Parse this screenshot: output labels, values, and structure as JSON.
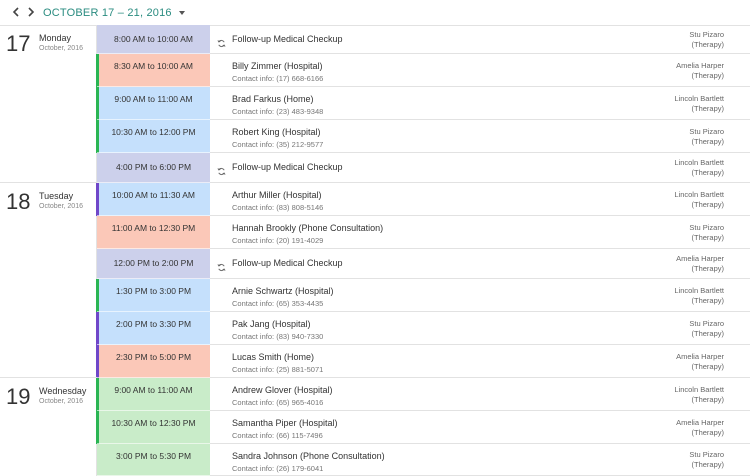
{
  "toolbar": {
    "range_label": "OCTOBER 17 – 21, 2016",
    "prev_icon": "chevron-left-icon",
    "next_icon": "chevron-right-icon"
  },
  "colors": {
    "accent": "#2a8c80",
    "purple_slot": "#ccd0eb",
    "salmon_slot": "#fbc8b8",
    "blue_slot": "#c5e0fc",
    "green_slot": "#c9ecc9",
    "green_marker": "#2ab553",
    "violet_marker": "#6f47c9"
  },
  "days": [
    {
      "num": "17",
      "name": "Monday",
      "month": "October, 2016"
    },
    {
      "num": "18",
      "name": "Tuesday",
      "month": "October, 2016"
    },
    {
      "num": "19",
      "name": "Wednesday",
      "month": "October, 2016"
    }
  ],
  "appointments": [
    {
      "day": 0,
      "time": "8:00 AM to 10:00 AM",
      "subject": "Follow-up Medical Checkup",
      "contact": "",
      "recurring": true,
      "resource": "Stu Pizaro",
      "dept": "(Therapy)",
      "color": "purple",
      "marker": ""
    },
    {
      "day": 0,
      "time": "8:30 AM to 10:00 AM",
      "subject": "Billy Zimmer (Hospital)",
      "contact": "Contact info: (17) 668-6166",
      "recurring": false,
      "resource": "Amelia Harper",
      "dept": "(Therapy)",
      "color": "salmon",
      "marker": "green"
    },
    {
      "day": 0,
      "time": "9:00 AM to 11:00 AM",
      "subject": "Brad Farkus (Home)",
      "contact": "Contact info: (23) 483-9348",
      "recurring": false,
      "resource": "Lincoln Bartlett",
      "dept": "(Therapy)",
      "color": "blue",
      "marker": "green"
    },
    {
      "day": 0,
      "time": "10:30 AM to 12:00 PM",
      "subject": "Robert King (Hospital)",
      "contact": "Contact info: (35) 212-9577",
      "recurring": false,
      "resource": "Stu Pizaro",
      "dept": "(Therapy)",
      "color": "blue",
      "marker": "green"
    },
    {
      "day": 0,
      "time": "4:00 PM to 6:00 PM",
      "subject": "Follow-up Medical Checkup",
      "contact": "",
      "recurring": true,
      "resource": "Lincoln Bartlett",
      "dept": "(Therapy)",
      "color": "purple",
      "marker": ""
    },
    {
      "day": 1,
      "time": "10:00 AM to 11:30 AM",
      "subject": "Arthur Miller (Hospital)",
      "contact": "Contact info: (83) 808-5146",
      "recurring": false,
      "resource": "Lincoln Bartlett",
      "dept": "(Therapy)",
      "color": "blue",
      "marker": "violet"
    },
    {
      "day": 1,
      "time": "11:00 AM to 12:30 PM",
      "subject": "Hannah Brookly (Phone Consultation)",
      "contact": "Contact info: (20) 191-4029",
      "recurring": false,
      "resource": "Stu Pizaro",
      "dept": "(Therapy)",
      "color": "salmon",
      "marker": ""
    },
    {
      "day": 1,
      "time": "12:00 PM to 2:00 PM",
      "subject": "Follow-up Medical Checkup",
      "contact": "",
      "recurring": true,
      "resource": "Amelia Harper",
      "dept": "(Therapy)",
      "color": "purple",
      "marker": ""
    },
    {
      "day": 1,
      "time": "1:30 PM to 3:00 PM",
      "subject": "Arnie Schwartz (Hospital)",
      "contact": "Contact info: (65) 353-4435",
      "recurring": false,
      "resource": "Lincoln Bartlett",
      "dept": "(Therapy)",
      "color": "blue",
      "marker": "green"
    },
    {
      "day": 1,
      "time": "2:00 PM to 3:30 PM",
      "subject": "Pak Jang (Hospital)",
      "contact": "Contact info: (83) 940-7330",
      "recurring": false,
      "resource": "Stu Pizaro",
      "dept": "(Therapy)",
      "color": "blue",
      "marker": "violet"
    },
    {
      "day": 1,
      "time": "2:30 PM to 5:00 PM",
      "subject": "Lucas Smith (Home)",
      "contact": "Contact info: (25) 881-5071",
      "recurring": false,
      "resource": "Amelia Harper",
      "dept": "(Therapy)",
      "color": "salmon",
      "marker": "violet"
    },
    {
      "day": 2,
      "time": "9:00 AM to 11:00 AM",
      "subject": "Andrew Glover (Hospital)",
      "contact": "Contact info: (65) 965-4016",
      "recurring": false,
      "resource": "Lincoln Bartlett",
      "dept": "(Therapy)",
      "color": "green",
      "marker": "green"
    },
    {
      "day": 2,
      "time": "10:30 AM to 12:30 PM",
      "subject": "Samantha Piper (Hospital)",
      "contact": "Contact info: (66) 115-7496",
      "recurring": false,
      "resource": "Amelia Harper",
      "dept": "(Therapy)",
      "color": "green",
      "marker": "green"
    },
    {
      "day": 2,
      "time": "3:00 PM to 5:30 PM",
      "subject": "Sandra Johnson (Phone Consultation)",
      "contact": "Contact info: (26) 179-6041",
      "recurring": false,
      "resource": "Stu Pizaro",
      "dept": "(Therapy)",
      "color": "green",
      "marker": ""
    }
  ]
}
